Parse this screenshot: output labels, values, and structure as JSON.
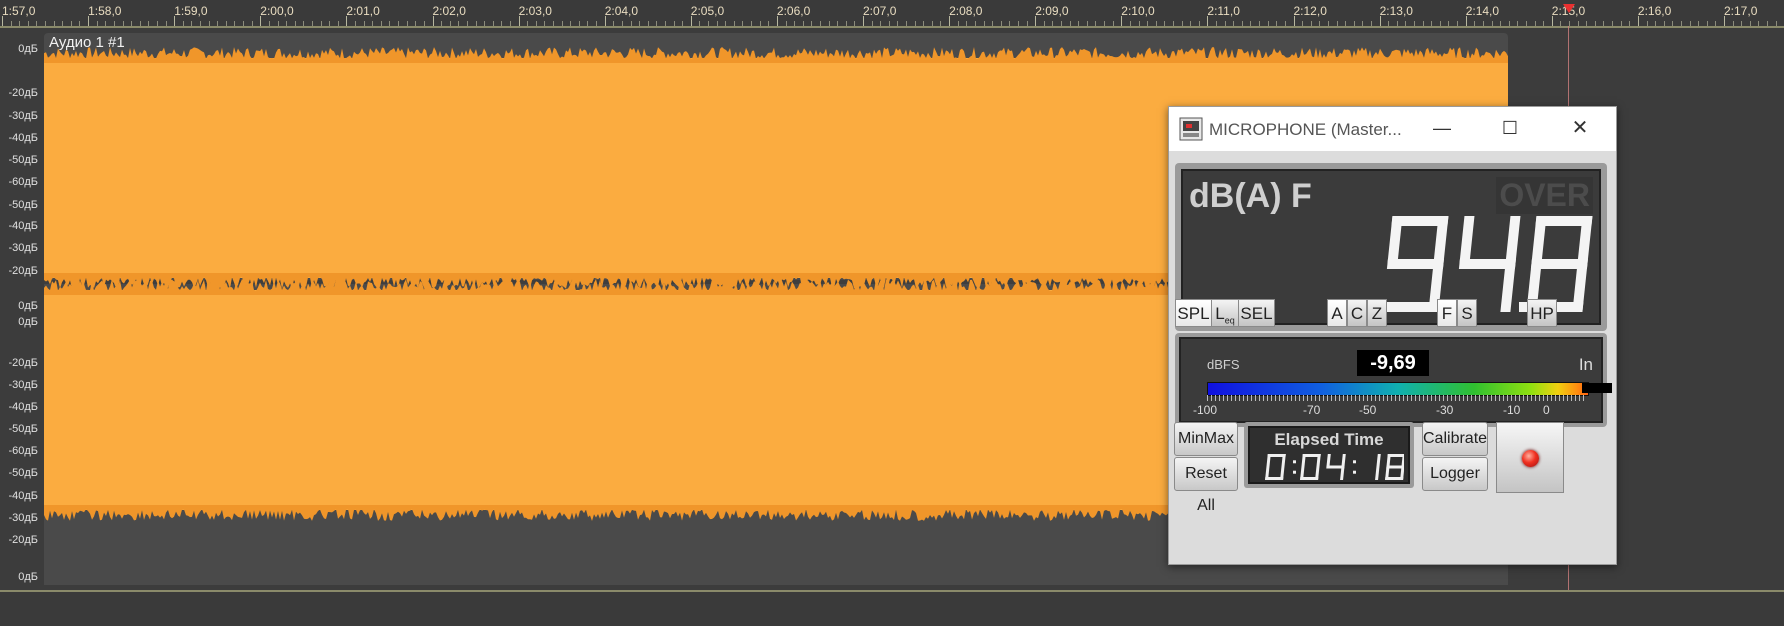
{
  "ruler": {
    "labels": [
      "1:57,0",
      "1:58,0",
      "1:59,0",
      "2:00,0",
      "2:01,0",
      "2:02,0",
      "2:03,0",
      "2:04,0",
      "2:05,0",
      "2:06,0",
      "2:07,0",
      "2:08,0",
      "2:09,0",
      "2:10,0",
      "2:11,0",
      "2:12,0",
      "2:13,0",
      "2:14,0",
      "2:15,0",
      "2:16,0",
      "2:17,0"
    ]
  },
  "db_scale": {
    "labels": [
      "0дБ",
      "-20дБ",
      "-30дБ",
      "-40дБ",
      "-50дБ",
      "-60дБ",
      "-50дБ",
      "-40дБ",
      "-30дБ",
      "-20дБ",
      "0дБ",
      "0дБ",
      "-20дБ",
      "-30дБ",
      "-40дБ",
      "-50дБ",
      "-60дБ",
      "-50дБ",
      "-40дБ",
      "-30дБ",
      "-20дБ",
      "0дБ"
    ]
  },
  "track": {
    "title": "Аудио 1 #1",
    "waveform_color": "#fbac40"
  },
  "meter": {
    "window_title": "MICROPHONE (Master...",
    "window_controls": {
      "minimize": "—",
      "maximize": "☐",
      "close": "✕"
    },
    "mode_label": "dB(A) F",
    "over_label": "OVER",
    "level_value": "94.8",
    "buttons": {
      "spl": "SPL",
      "leq": "L",
      "leq_sub": "eq",
      "sel": "SEL",
      "a": "A",
      "c": "C",
      "z": "Z",
      "f": "F",
      "s": "S",
      "hp": "HP"
    },
    "dbfs": {
      "label": "dBFS",
      "value": "-9,69",
      "input": "In",
      "scale": [
        "-100",
        "-70",
        "-50",
        "-30",
        "-10",
        "0"
      ]
    },
    "minmax": "MinMax",
    "reset_all": "Reset All",
    "elapsed_title": "Elapsed Time",
    "elapsed_value": "0:04:18",
    "calibrate": "Calibrate",
    "logger": "Logger"
  }
}
